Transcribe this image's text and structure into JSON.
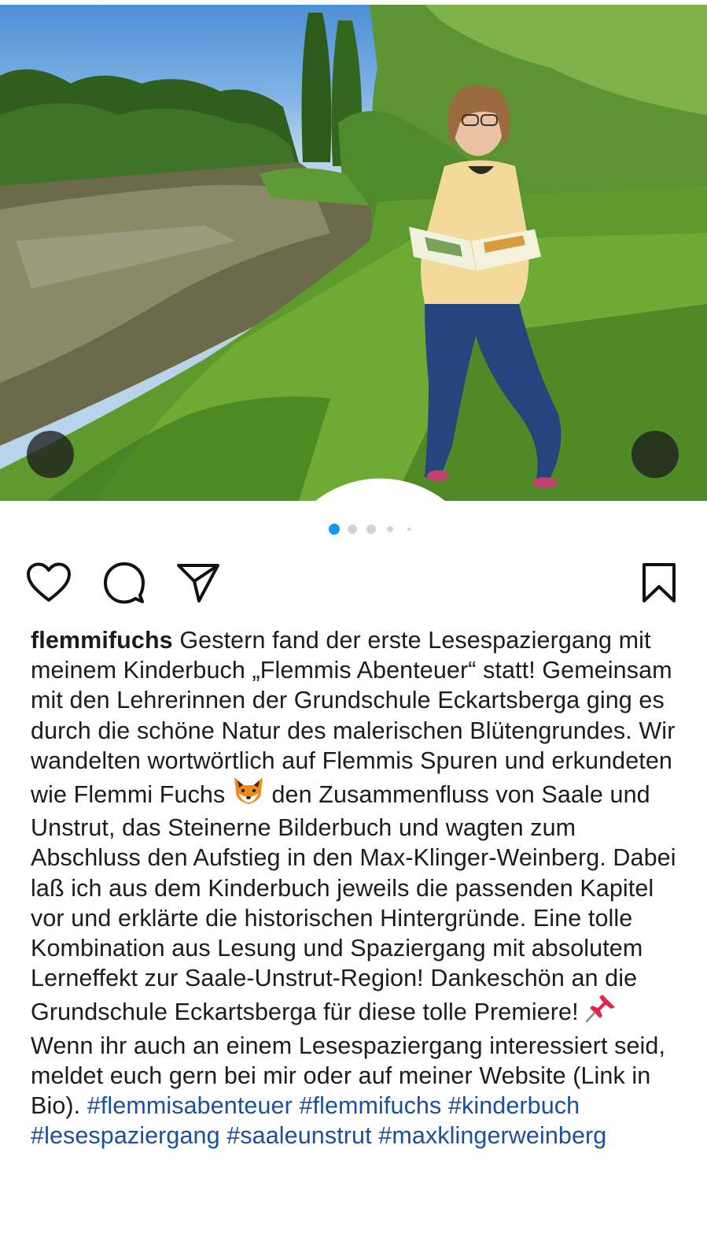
{
  "post": {
    "username": "flemmifuchs",
    "caption_parts": [
      "Gestern fand der erste Lesespaziergang mit meinem Kinderbuch „Flemmis Abenteuer“ statt! Gemeinsam mit den Lehrerinnen der Grundschule Eckartsberga ging es durch die schöne Natur des malerischen Blütengrundes. Wir wandelten wortwörtlich auf Flemmis Spuren und erkundeten wie Flemmi Fuchs",
      "den Zusammenfluss von Saale und Unstrut, das Steinerne Bilderbuch und wagten zum Abschluss den Aufstieg in den Max-Klinger-Weinberg. Dabei laß ich aus dem Kinderbuch jeweils die passenden Kapitel vor und erklärte die historischen Hintergründe. Eine tolle Kombination aus Lesung und Spaziergang mit absolutem Lerneffekt zur Saale-Unstrut-Region! Dankeschön an die Grundschule Eckartsberga für diese tolle Premiere!",
      "Wenn ihr auch an einem Lesespaziergang interessiert seid, meldet euch gern bei mir oder auf meiner Website (Link in Bio)."
    ],
    "emojis": [
      "fox-emoji",
      "pushpin-emoji"
    ],
    "hashtags": [
      "#flemmisabenteuer",
      "#flemmifuchs",
      "#kinderbuch",
      "#lesespaziergang",
      "#saaleunstrut",
      "#maxklingerweinberg"
    ]
  },
  "carousel": {
    "total": 5,
    "active_index": 0
  },
  "icons": {
    "like": "heart-icon",
    "comment": "comment-icon",
    "share": "send-icon",
    "save": "bookmark-icon",
    "tagged": "person-icon",
    "sound": "speaker-icon"
  },
  "colors": {
    "accent": "#1596f0",
    "hashtag": "#1a4f9c"
  }
}
